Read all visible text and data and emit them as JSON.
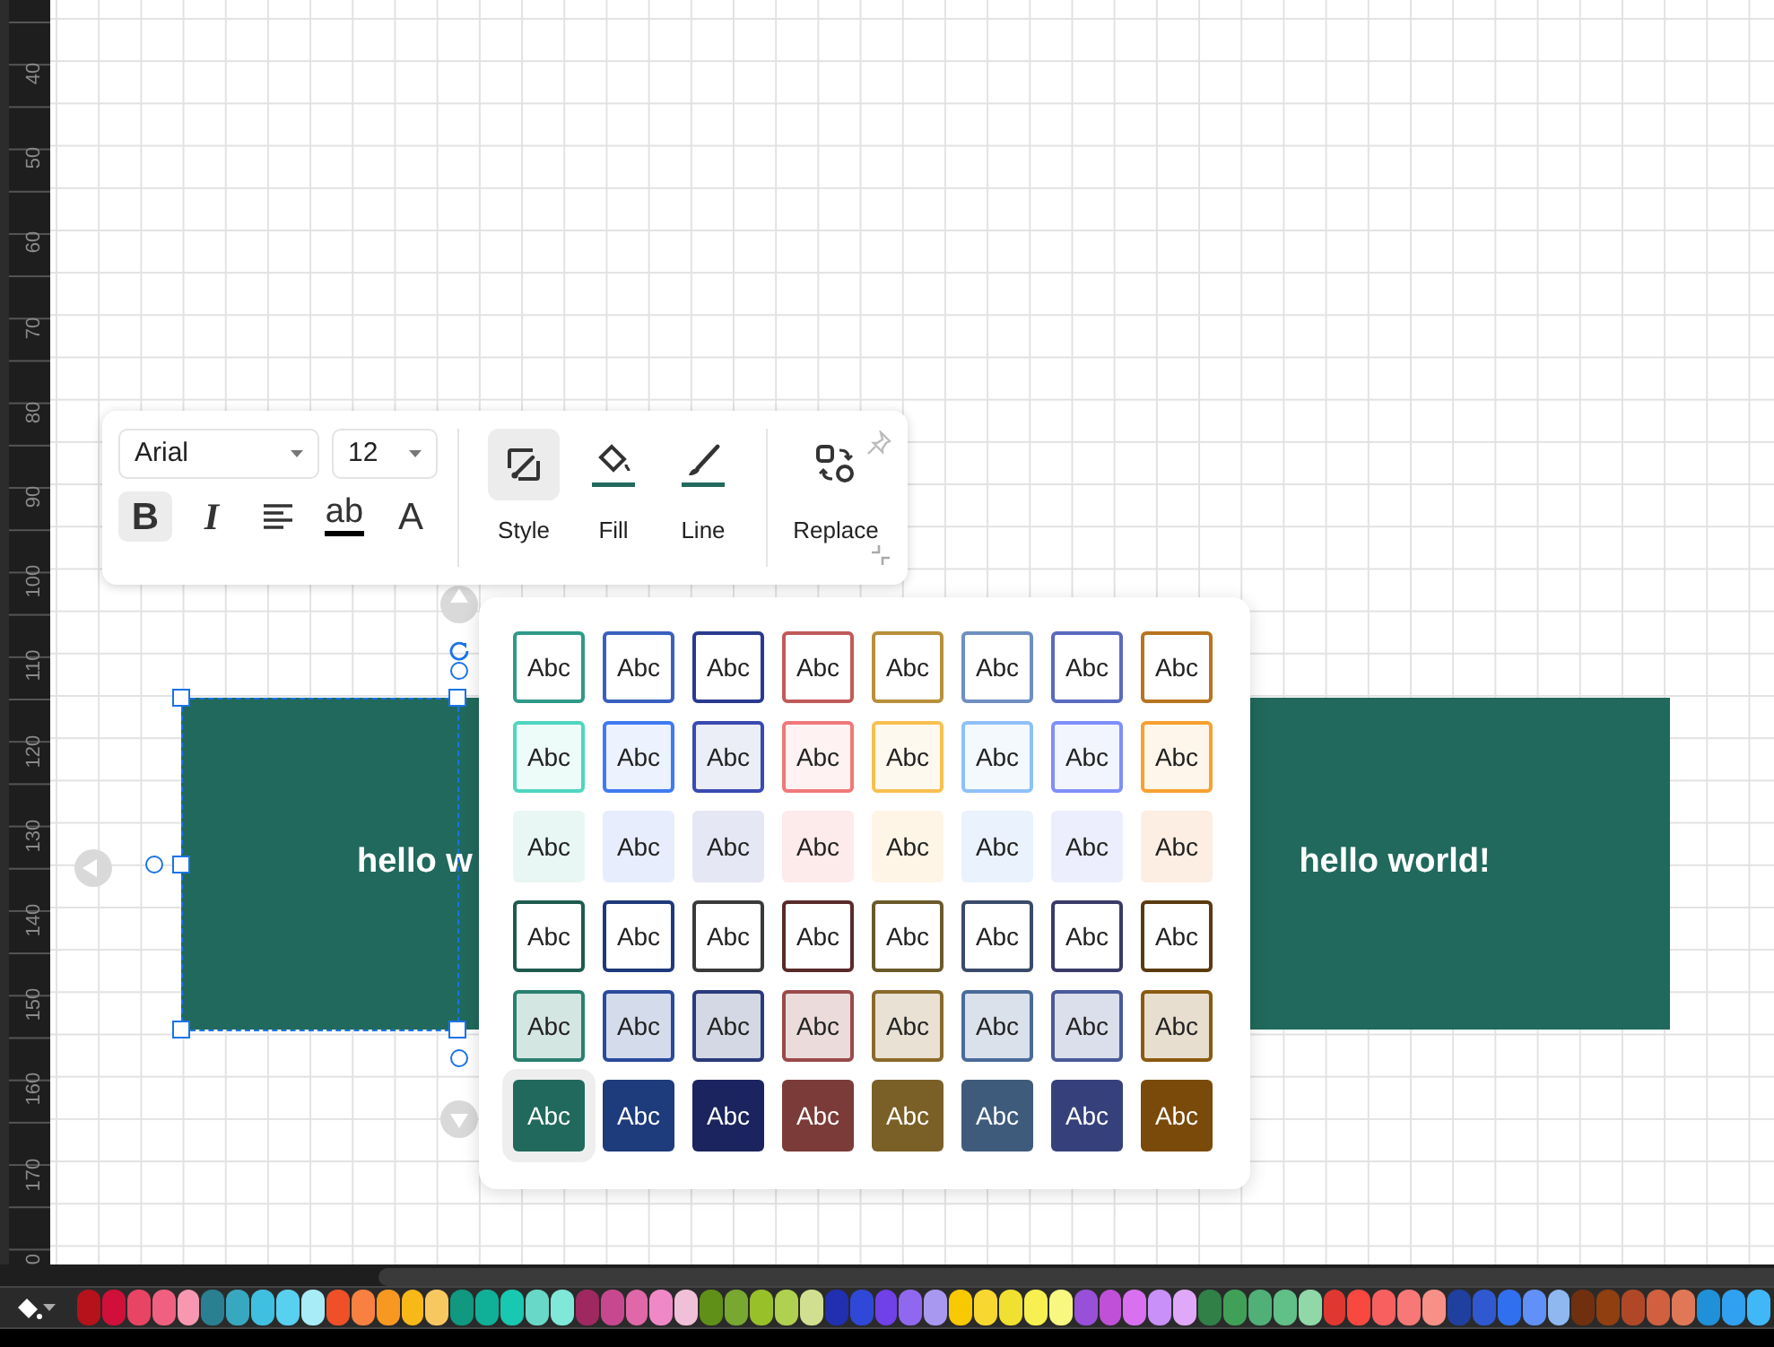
{
  "ruler": {
    "labels": [
      "40",
      "50",
      "60",
      "70",
      "80",
      "90",
      "100",
      "110",
      "120",
      "130",
      "140",
      "150",
      "160",
      "170",
      "0"
    ]
  },
  "toolbar": {
    "font": {
      "value": "Arial"
    },
    "size": {
      "value": "12"
    },
    "format_buttons": [
      {
        "kind": "bold",
        "label": "B",
        "selected": true
      },
      {
        "kind": "italic",
        "label": "I",
        "selected": false
      },
      {
        "kind": "align",
        "selected": false
      },
      {
        "kind": "underline",
        "label": "ab",
        "selected": false
      },
      {
        "kind": "font_color",
        "label": "A",
        "selected": false
      }
    ],
    "tools": [
      {
        "kind": "style",
        "label": "Style",
        "selected": true
      },
      {
        "kind": "fill",
        "label": "Fill",
        "selected": false
      },
      {
        "kind": "line",
        "label": "Line",
        "selected": false
      },
      {
        "kind": "replace",
        "label": "Replace",
        "selected": false
      }
    ]
  },
  "shapes": [
    {
      "text": "hello w",
      "selected": true
    },
    {
      "text": "hello world!",
      "selected": false
    }
  ],
  "style_panel": {
    "rows": [
      {
        "kind": "outline",
        "items": [
          {
            "label": "Abc",
            "color": "#2f9a88",
            "selected": false
          },
          {
            "label": "Abc",
            "color": "#3a5fc0",
            "selected": false
          },
          {
            "label": "Abc",
            "color": "#2b3a8f",
            "selected": false
          },
          {
            "label": "Abc",
            "color": "#c05a5a",
            "selected": false
          },
          {
            "label": "Abc",
            "color": "#b8903a",
            "selected": false
          },
          {
            "label": "Abc",
            "color": "#6f8fc0",
            "selected": false
          },
          {
            "label": "Abc",
            "color": "#5a6ac0",
            "selected": false
          },
          {
            "label": "Abc",
            "color": "#b87420",
            "selected": false
          }
        ]
      },
      {
        "kind": "light",
        "items": [
          {
            "label": "Abc",
            "color": "#4fd6c0",
            "selected": false
          },
          {
            "label": "Abc",
            "color": "#3f7af0",
            "selected": false
          },
          {
            "label": "Abc",
            "color": "#3a4ab0",
            "selected": false
          },
          {
            "label": "Abc",
            "color": "#f07878",
            "selected": false
          },
          {
            "label": "Abc",
            "color": "#f8c050",
            "selected": false
          },
          {
            "label": "Abc",
            "color": "#8fc0f8",
            "selected": false
          },
          {
            "label": "Abc",
            "color": "#7f8ff8",
            "selected": false
          },
          {
            "label": "Abc",
            "color": "#f8a030",
            "selected": false
          }
        ]
      },
      {
        "kind": "tint",
        "items": [
          {
            "label": "Abc",
            "color": "#e8f7f4",
            "selected": false
          },
          {
            "label": "Abc",
            "color": "#e8edfd",
            "selected": false
          },
          {
            "label": "Abc",
            "color": "#e6e7f4",
            "selected": false
          },
          {
            "label": "Abc",
            "color": "#fdeaea",
            "selected": false
          },
          {
            "label": "Abc",
            "color": "#fff5e6",
            "selected": false
          },
          {
            "label": "Abc",
            "color": "#eaf2fd",
            "selected": false
          },
          {
            "label": "Abc",
            "color": "#eceefd",
            "selected": false
          },
          {
            "label": "Abc",
            "color": "#fdeee3",
            "selected": false
          }
        ]
      },
      {
        "kind": "outline",
        "items": [
          {
            "label": "Abc",
            "color": "#1f5a4e",
            "selected": false
          },
          {
            "label": "Abc",
            "color": "#1f3a7a",
            "selected": false
          },
          {
            "label": "Abc",
            "color": "#3a3a3a",
            "selected": false
          },
          {
            "label": "Abc",
            "color": "#5a2a2a",
            "selected": false
          },
          {
            "label": "Abc",
            "color": "#6a5a2a",
            "selected": false
          },
          {
            "label": "Abc",
            "color": "#3a4a6a",
            "selected": false
          },
          {
            "label": "Abc",
            "color": "#3a3a6a",
            "selected": false
          },
          {
            "label": "Abc",
            "color": "#5a3a10",
            "selected": false
          }
        ]
      },
      {
        "kind": "soft",
        "items": [
          {
            "label": "Abc",
            "color": "#2a8070",
            "selected": false
          },
          {
            "label": "Abc",
            "color": "#2a4a9a",
            "selected": false
          },
          {
            "label": "Abc",
            "color": "#2a3a7a",
            "selected": false
          },
          {
            "label": "Abc",
            "color": "#9a4a4a",
            "selected": false
          },
          {
            "label": "Abc",
            "color": "#8a6a2a",
            "selected": false
          },
          {
            "label": "Abc",
            "color": "#4a6a9a",
            "selected": false
          },
          {
            "label": "Abc",
            "color": "#4a5a9a",
            "selected": false
          },
          {
            "label": "Abc",
            "color": "#8a5a10",
            "selected": false
          }
        ]
      },
      {
        "kind": "solid",
        "items": [
          {
            "label": "Abc",
            "color": "#21695c",
            "selected": true
          },
          {
            "label": "Abc",
            "color": "#1e3b7b",
            "selected": false
          },
          {
            "label": "Abc",
            "color": "#1b245e",
            "selected": false
          },
          {
            "label": "Abc",
            "color": "#7b3b38",
            "selected": false
          },
          {
            "label": "Abc",
            "color": "#7a6026",
            "selected": false
          },
          {
            "label": "Abc",
            "color": "#3f5b7b",
            "selected": false
          },
          {
            "label": "Abc",
            "color": "#36417b",
            "selected": false
          },
          {
            "label": "Abc",
            "color": "#7a4a0a",
            "selected": false
          }
        ]
      }
    ]
  },
  "palette": [
    {
      "color": "#b5121b"
    },
    {
      "color": "#d0103a"
    },
    {
      "color": "#e84464"
    },
    {
      "color": "#f06080"
    },
    {
      "color": "#f898b0"
    },
    {
      "color": "#2a8090"
    },
    {
      "color": "#38a8c0"
    },
    {
      "color": "#40c0e0"
    },
    {
      "color": "#58d0f0"
    },
    {
      "color": "#a8ecf8"
    },
    {
      "color": "#f05028"
    },
    {
      "color": "#f88040"
    },
    {
      "color": "#f89820"
    },
    {
      "color": "#f8b818"
    },
    {
      "color": "#f8c860"
    },
    {
      "color": "#109880"
    },
    {
      "color": "#10b098"
    },
    {
      "color": "#18c8b0"
    },
    {
      "color": "#68d8c8"
    },
    {
      "color": "#80e8d8"
    },
    {
      "color": "#a02860"
    },
    {
      "color": "#c84890"
    },
    {
      "color": "#e068a8"
    },
    {
      "color": "#f088c8"
    },
    {
      "color": "#f0c0d8"
    },
    {
      "color": "#609018"
    },
    {
      "color": "#78a830"
    },
    {
      "color": "#98c028"
    },
    {
      "color": "#b0d050"
    },
    {
      "color": "#d0e090"
    },
    {
      "color": "#2030b0"
    },
    {
      "color": "#3048d8"
    },
    {
      "color": "#7040e8"
    },
    {
      "color": "#9068f0"
    },
    {
      "color": "#a898f0"
    },
    {
      "color": "#f8c800"
    },
    {
      "color": "#f8d830"
    },
    {
      "color": "#f0e030"
    },
    {
      "color": "#f8f050"
    },
    {
      "color": "#f8f880"
    },
    {
      "color": "#9850d8"
    },
    {
      "color": "#c050d8"
    },
    {
      "color": "#d870f0"
    },
    {
      "color": "#c890f8"
    },
    {
      "color": "#e0a8f8"
    },
    {
      "color": "#308048"
    },
    {
      "color": "#40a058"
    },
    {
      "color": "#50b078"
    },
    {
      "color": "#60c088"
    },
    {
      "color": "#90d8a8"
    },
    {
      "color": "#e03830"
    },
    {
      "color": "#f84840"
    },
    {
      "color": "#f86060"
    },
    {
      "color": "#f87878"
    },
    {
      "color": "#f89088"
    },
    {
      "color": "#2040a0"
    },
    {
      "color": "#3058d0"
    },
    {
      "color": "#3070f0"
    },
    {
      "color": "#6090f8"
    },
    {
      "color": "#90b8f0"
    },
    {
      "color": "#703010"
    },
    {
      "color": "#904010"
    },
    {
      "color": "#b04828"
    },
    {
      "color": "#d06040"
    },
    {
      "color": "#e07858"
    },
    {
      "color": "#2090d8"
    },
    {
      "color": "#30a0f0"
    },
    {
      "color": "#40b8f8"
    }
  ]
}
